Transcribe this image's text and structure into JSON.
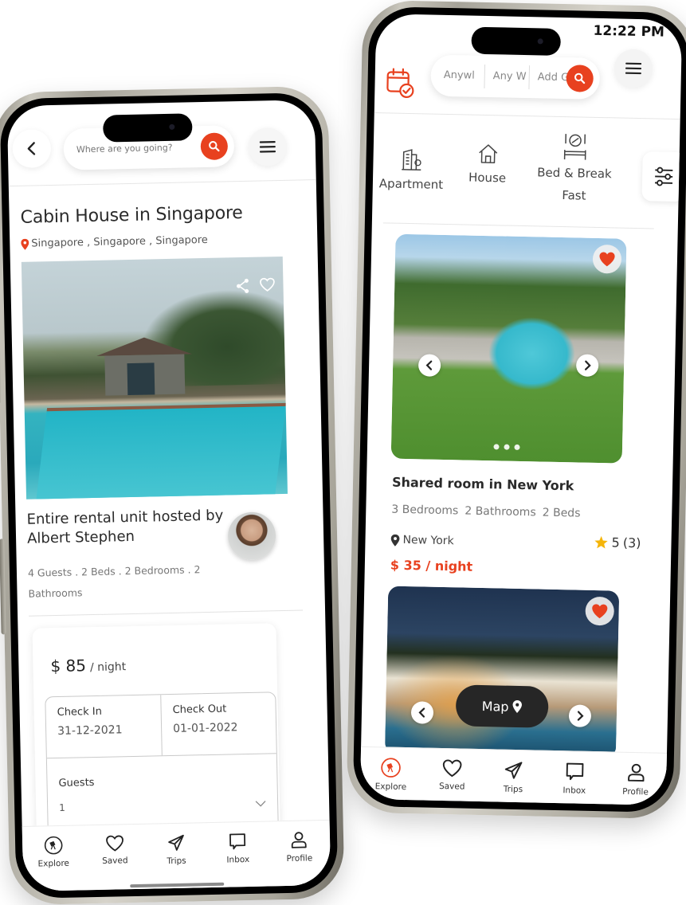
{
  "colors": {
    "accent": "#e8411f",
    "star": "#f5b50a",
    "text_primary": "#2a2a2a",
    "text_secondary": "#777777"
  },
  "left_phone": {
    "header": {
      "back_icon": "chevron-left-icon",
      "search_placeholder": "Where are you going?",
      "search_icon": "search-icon",
      "menu_icon": "hamburger-menu-icon"
    },
    "listing": {
      "title": "Cabin House in Singapore",
      "location": "Singapore , Singapore , Singapore",
      "photo_actions": [
        "share-icon",
        "heart-outline-icon"
      ],
      "host_line": "Entire rental unit hosted by Albert Stephen",
      "details": "4 Guests . 2 Beds . 2 Bedrooms . 2 Bathrooms"
    },
    "booking": {
      "price": "$ 85",
      "price_unit": "/ night",
      "check_in_label": "Check In",
      "check_in_value": "31-12-2021",
      "check_out_label": "Check Out",
      "check_out_value": "01-01-2022",
      "guests_label": "Guests",
      "guests_value": "1"
    },
    "bottom_nav": [
      {
        "label": "Explore",
        "icon": "binoculars-icon",
        "active": false
      },
      {
        "label": "Saved",
        "icon": "heart-icon",
        "active": false
      },
      {
        "label": "Trips",
        "icon": "paper-plane-icon",
        "active": false
      },
      {
        "label": "Inbox",
        "icon": "chat-bubble-icon",
        "active": false
      },
      {
        "label": "Profile",
        "icon": "user-icon",
        "active": false
      }
    ]
  },
  "right_phone": {
    "status_bar": {
      "time": "12:22 PM"
    },
    "header": {
      "calendar_icon": "calendar-check-icon",
      "search_segments": [
        "Anywhere",
        "Any Week",
        "Add Guests"
      ],
      "search_segments_visible": [
        "Anywl",
        "Any W",
        "Add G"
      ],
      "search_icon": "search-icon",
      "menu_icon": "hamburger-menu-icon"
    },
    "categories": [
      {
        "label": "Apartment",
        "icon": "apartment-building-icon"
      },
      {
        "label": "House",
        "icon": "house-icon"
      },
      {
        "label": "Bed & Break Fast",
        "label_line1": "Bed & Break",
        "label_line2": "Fast",
        "icon": "bed-breakfast-icon"
      }
    ],
    "filter_icon": "sliders-icon",
    "listings": [
      {
        "title": "Shared room in New York",
        "specs": [
          "3 Bedrooms",
          "2 Bathrooms",
          "2 Beds"
        ],
        "location": "New York",
        "rating": "5",
        "reviews": "(3)",
        "price": "$ 35 / night",
        "favorited": true,
        "carousel_dots": 3
      },
      {
        "favorited": true
      }
    ],
    "map_button": "Map",
    "bottom_nav": [
      {
        "label": "Explore",
        "icon": "binoculars-icon",
        "active": true
      },
      {
        "label": "Saved",
        "icon": "heart-icon",
        "active": false
      },
      {
        "label": "Trips",
        "icon": "paper-plane-icon",
        "active": false
      },
      {
        "label": "Inbox",
        "icon": "chat-bubble-icon",
        "active": false
      },
      {
        "label": "Profile",
        "icon": "user-icon",
        "active": false
      }
    ]
  }
}
